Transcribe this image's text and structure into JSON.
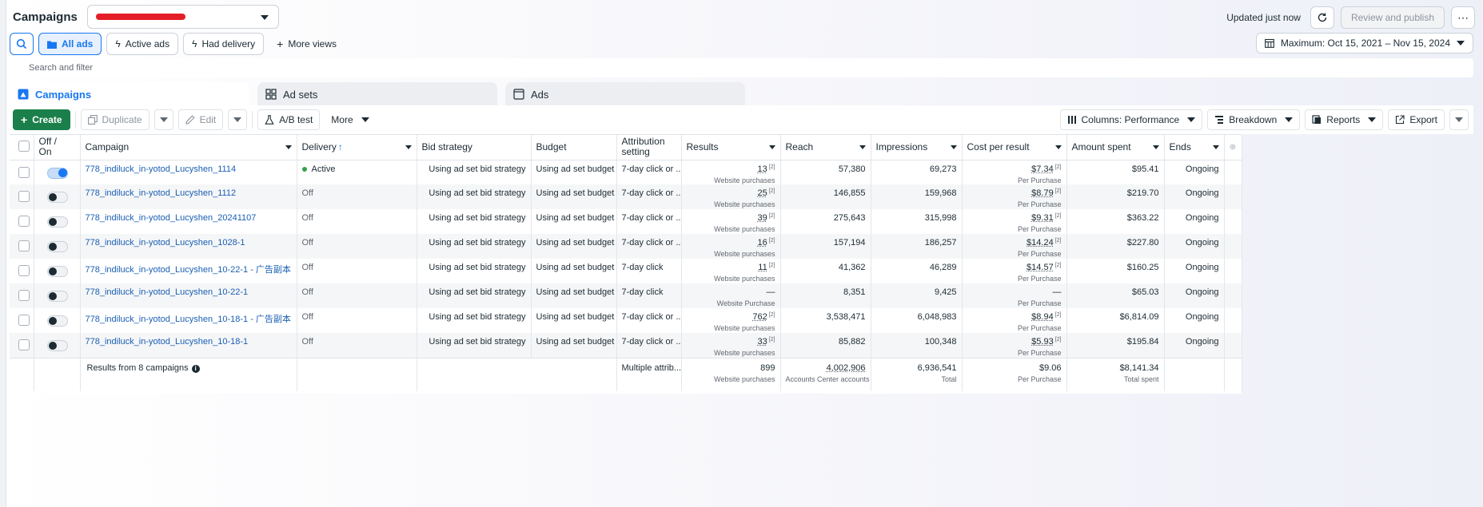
{
  "header": {
    "title": "Campaigns",
    "updated": "Updated just now",
    "review_label": "Review and publish",
    "more_label": "⋯"
  },
  "views": {
    "all_ads": "All ads",
    "active_ads": "Active ads",
    "had_delivery": "Had delivery",
    "more_views": "More views",
    "date_range": "Maximum: Oct 15, 2021 – Nov 15, 2024"
  },
  "search": {
    "placeholder": "Search and filter"
  },
  "tabs": {
    "campaigns": "Campaigns",
    "ad_sets": "Ad sets",
    "ads": "Ads"
  },
  "toolbar": {
    "create": "Create",
    "duplicate": "Duplicate",
    "edit": "Edit",
    "ab_test": "A/B test",
    "more": "More",
    "columns": "Columns: Performance",
    "breakdown": "Breakdown",
    "reports": "Reports",
    "export": "Export"
  },
  "columns": {
    "off_on": "Off / On",
    "campaign": "Campaign",
    "delivery": "Delivery",
    "bid_strategy": "Bid strategy",
    "budget": "Budget",
    "attribution": "Attribution setting",
    "results": "Results",
    "reach": "Reach",
    "impressions": "Impressions",
    "cost_per_result": "Cost per result",
    "amount_spent": "Amount spent",
    "ends": "Ends"
  },
  "rows": [
    {
      "on": true,
      "name": "778_indiluck_in-yotod_Lucyshen_1114",
      "delivery": "Active",
      "bid": "Using ad set bid strategy",
      "budget": "Using ad set budget",
      "attribution": "7-day click or ...",
      "results": "13",
      "results_sub": "Website purchases",
      "reach": "57,380",
      "impressions": "69,273",
      "cpr": "$7.34",
      "cpr_sub": "Per Purchase",
      "spent": "$95.41",
      "ends": "Ongoing"
    },
    {
      "on": false,
      "name": "778_indiluck_in-yotod_Lucyshen_1112",
      "delivery": "Off",
      "bid": "Using ad set bid strategy",
      "budget": "Using ad set budget",
      "attribution": "7-day click or ...",
      "results": "25",
      "results_sub": "Website purchases",
      "reach": "146,855",
      "impressions": "159,968",
      "cpr": "$8.79",
      "cpr_sub": "Per Purchase",
      "spent": "$219.70",
      "ends": "Ongoing"
    },
    {
      "on": false,
      "name": "778_indiluck_in-yotod_Lucyshen_20241107",
      "delivery": "Off",
      "bid": "Using ad set bid strategy",
      "budget": "Using ad set budget",
      "attribution": "7-day click or ...",
      "results": "39",
      "results_sub": "Website purchases",
      "reach": "275,643",
      "impressions": "315,998",
      "cpr": "$9.31",
      "cpr_sub": "Per Purchase",
      "spent": "$363.22",
      "ends": "Ongoing"
    },
    {
      "on": false,
      "name": "778_indiluck_in-yotod_Lucyshen_1028-1",
      "delivery": "Off",
      "bid": "Using ad set bid strategy",
      "budget": "Using ad set budget",
      "attribution": "7-day click or ...",
      "results": "16",
      "results_sub": "Website purchases",
      "reach": "157,194",
      "impressions": "186,257",
      "cpr": "$14.24",
      "cpr_sub": "Per Purchase",
      "spent": "$227.80",
      "ends": "Ongoing"
    },
    {
      "on": false,
      "name": "778_indiluck_in-yotod_Lucyshen_10-22-1 - 广告副本",
      "delivery": "Off",
      "bid": "Using ad set bid strategy",
      "budget": "Using ad set budget",
      "attribution": "7-day click",
      "results": "11",
      "results_sub": "Website purchases",
      "reach": "41,362",
      "impressions": "46,289",
      "cpr": "$14.57",
      "cpr_sub": "Per Purchase",
      "spent": "$160.25",
      "ends": "Ongoing"
    },
    {
      "on": false,
      "name": "778_indiluck_in-yotod_Lucyshen_10-22-1",
      "delivery": "Off",
      "bid": "Using ad set bid strategy",
      "budget": "Using ad set budget",
      "attribution": "7-day click",
      "results": "—",
      "results_sub": "Website Purchase",
      "reach": "8,351",
      "impressions": "9,425",
      "cpr": "—",
      "cpr_sub": "Per Purchase",
      "spent": "$65.03",
      "ends": "Ongoing"
    },
    {
      "on": false,
      "name": "778_indiluck_in-yotod_Lucyshen_10-18-1 - 广告副本",
      "delivery": "Off",
      "bid": "Using ad set bid strategy",
      "budget": "Using ad set budget",
      "attribution": "7-day click or ...",
      "results": "762",
      "results_sub": "Website purchases",
      "reach": "3,538,471",
      "impressions": "6,048,983",
      "cpr": "$8.94",
      "cpr_sub": "Per Purchase",
      "spent": "$6,814.09",
      "ends": "Ongoing"
    },
    {
      "on": false,
      "name": "778_indiluck_in-yotod_Lucyshen_10-18-1",
      "delivery": "Off",
      "bid": "Using ad set bid strategy",
      "budget": "Using ad set budget",
      "attribution": "7-day click or ...",
      "results": "33",
      "results_sub": "Website purchases",
      "reach": "85,882",
      "impressions": "100,348",
      "cpr": "$5.93",
      "cpr_sub": "Per Purchase",
      "spent": "$195.84",
      "ends": "Ongoing"
    }
  ],
  "totals": {
    "label": "Results from 8 campaigns",
    "attribution": "Multiple attrib...",
    "results": "899",
    "results_sub": "Website purchases",
    "reach": "4,002,906",
    "reach_sub": "Accounts Center accounts",
    "impressions": "6,936,541",
    "impressions_sub": "Total",
    "cpr": "$9.06",
    "cpr_sub": "Per Purchase",
    "spent": "$8,141.34",
    "spent_sub": "Total spent"
  },
  "colors": {
    "accent": "#1877f2",
    "create": "#1b7f4b",
    "active_dot": "#31a24c",
    "link": "#1a5fb4"
  }
}
